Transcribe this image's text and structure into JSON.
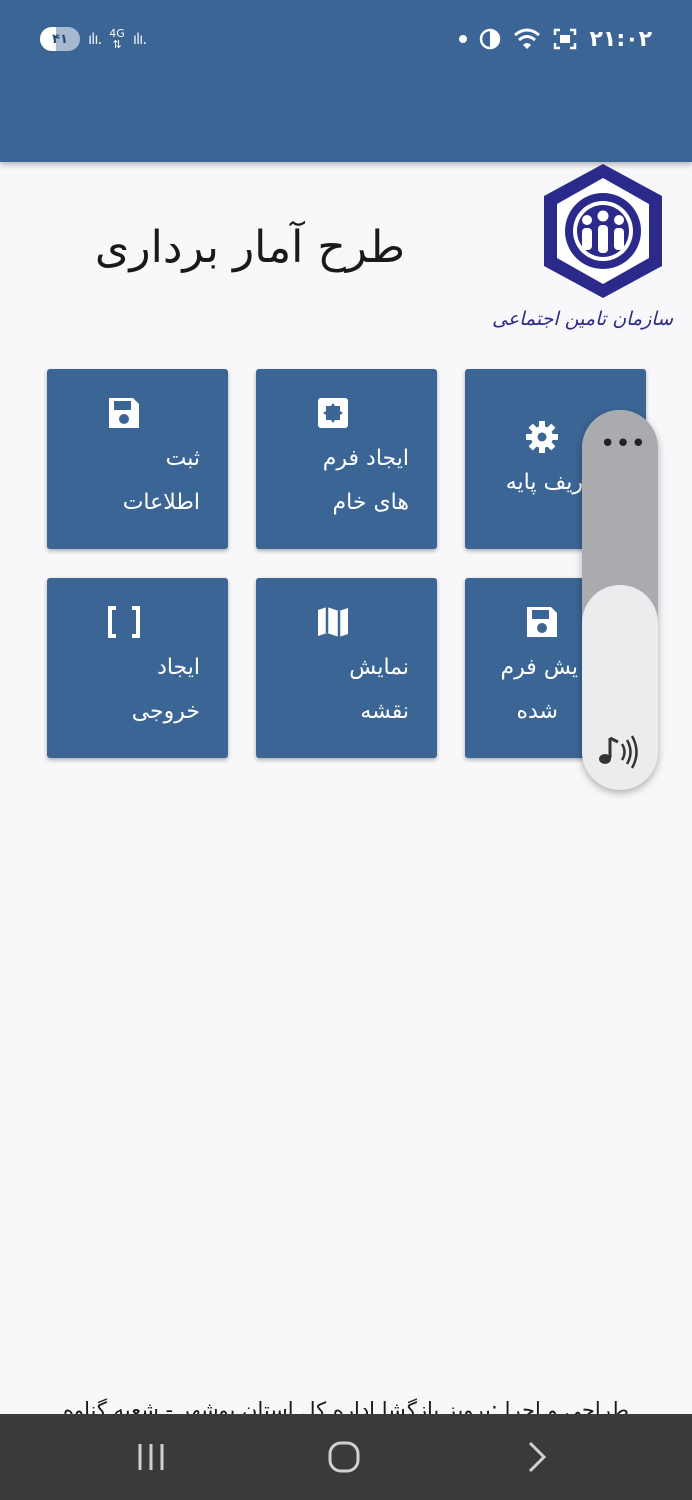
{
  "status_bar": {
    "clock": "۲۱:۰۲",
    "battery_percent": "۴۱",
    "network_type": "4G",
    "battery_level": 0.41
  },
  "header": {
    "title": "طرح آمار برداری",
    "logo_caption": "سازمان تامین اجتماعی"
  },
  "tiles": [
    {
      "line1": "ثبت",
      "line2": "اطلاعات",
      "icon": "save-icon"
    },
    {
      "line1": "ایجاد فرم",
      "line2": "های خام",
      "icon": "puzzle-icon"
    },
    {
      "line1": "ریف پایه",
      "line2": "",
      "icon": "gear-icon"
    },
    {
      "line1": "ایجاد",
      "line2": "خروجی",
      "icon": "brackets-icon"
    },
    {
      "line1": "نمایش",
      "line2": "نقشه",
      "icon": "map-icon"
    },
    {
      "line1": "یش فرم",
      "line2": "شده",
      "icon": "save-icon"
    }
  ],
  "floating_panel": {
    "more_label": "•••",
    "volume_level": 0.46
  },
  "footer": {
    "credit": "طراحی و اجرا :پرویز بازگشا اداره کل استان بوشهر - شعبه گناوه"
  },
  "colors": {
    "primary": "#3b6594",
    "logo_blue": "#2b2a8a",
    "background": "#f8f8fa",
    "nav_bar": "#3a3a3c"
  }
}
